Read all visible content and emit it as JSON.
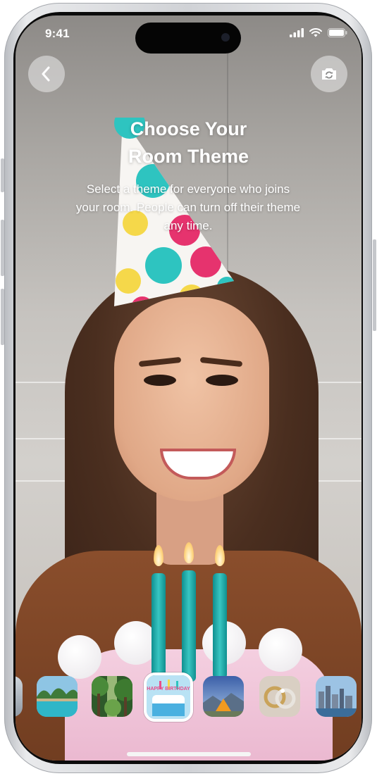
{
  "status_bar": {
    "time": "9:41"
  },
  "header": {
    "back_icon": "chevron-left-icon",
    "switch_camera_icon": "camera-rotate-icon",
    "title_line1": "Choose Your",
    "title_line2": "Room Theme",
    "subtitle": "Select a theme for everyone who joins your room. People can turn off their theme any time."
  },
  "themes": {
    "selected_index": 2,
    "items": [
      {
        "name": "pool-theme",
        "selected": false
      },
      {
        "name": "forest-theme",
        "selected": false
      },
      {
        "name": "birthday-theme",
        "label": "HAPPY BIRTHDAY",
        "selected": true
      },
      {
        "name": "camping-theme",
        "selected": false
      },
      {
        "name": "rings-theme",
        "selected": false
      },
      {
        "name": "city-theme",
        "selected": false
      }
    ]
  },
  "colors": {
    "accent_teal": "#2ec4c0",
    "hat_pink": "#e6336e",
    "hat_yellow": "#f5d84a"
  }
}
